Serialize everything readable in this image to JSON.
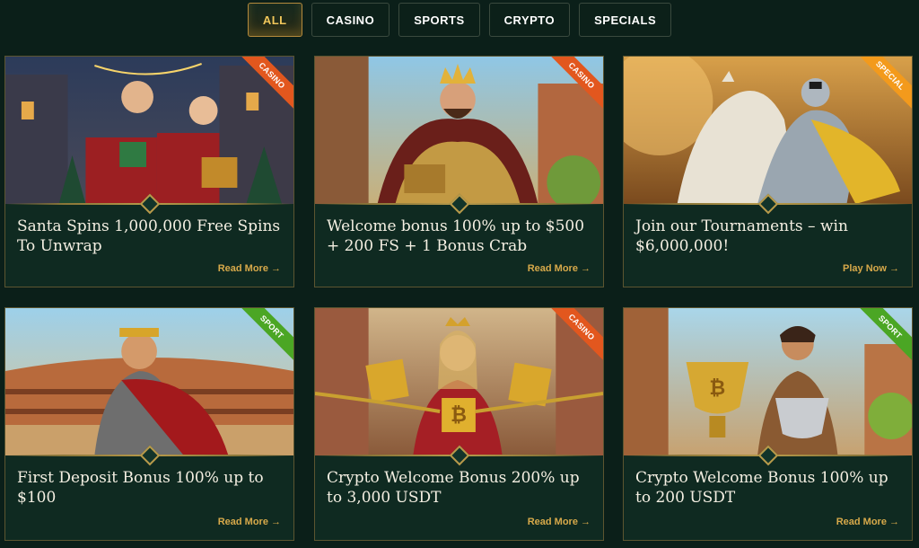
{
  "tabs": [
    {
      "label": "ALL",
      "active": true
    },
    {
      "label": "CASINO",
      "active": false
    },
    {
      "label": "SPORTS",
      "active": false
    },
    {
      "label": "CRYPTO",
      "active": false
    },
    {
      "label": "SPECIALS",
      "active": false
    }
  ],
  "cards": [
    {
      "title": "Santa Spins 1,000,000 Free Spins To Unwrap",
      "ribbon": "CASINO",
      "link": "Read More →"
    },
    {
      "title": "Welcome bonus 100% up to $500 + 200 FS + 1 Bonus Crab",
      "ribbon": "CASINO",
      "link": "Read More →"
    },
    {
      "title": "Join our Tournaments – win $6,000,000!",
      "ribbon": "SPECIAL",
      "link": "Play Now →"
    },
    {
      "title": "First Deposit Bonus 100% up to $100",
      "ribbon": "SPORT",
      "link": "Read More →"
    },
    {
      "title": "Crypto Welcome Bonus 200% up to 3,000 USDT",
      "ribbon": "CASINO",
      "link": "Read More →"
    },
    {
      "title": "Crypto Welcome Bonus 100% up to 200 USDT",
      "ribbon": "SPORT",
      "link": "Read More →"
    }
  ],
  "colors": {
    "background": "#0b1f19",
    "card": "#0f2a21",
    "accent_gold": "#d7a94a",
    "casino_ribbon": "#e2571e",
    "special_ribbon": "#f39a1c",
    "sport_ribbon": "#4ba624"
  }
}
